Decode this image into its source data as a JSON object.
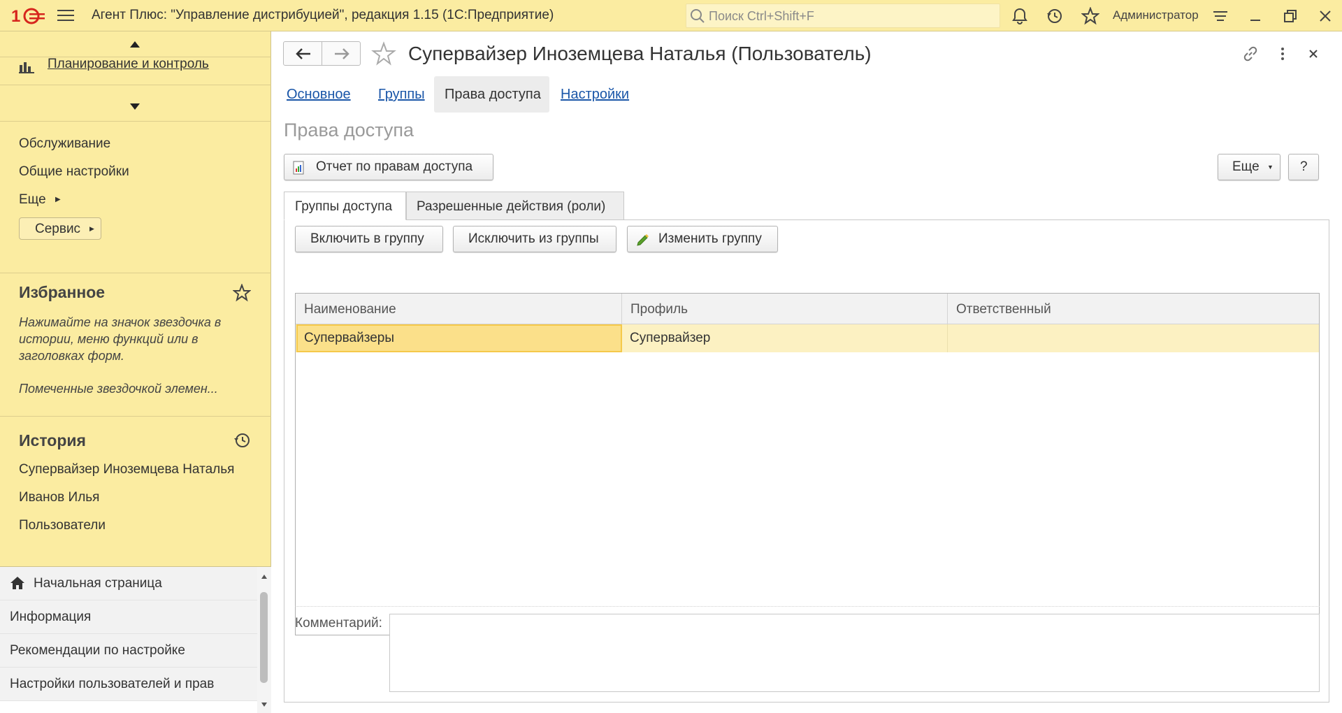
{
  "titlebar": {
    "app_title": "Агент Плюс: \"Управление дистрибуцией\", редакция 1.15  (1С:Предприятие)",
    "search_placeholder": "Поиск Ctrl+Shift+F",
    "user": "Администратор"
  },
  "sidebar": {
    "planning": "Планирование и контроль",
    "links": [
      "Обслуживание",
      "Общие настройки",
      "Еще"
    ],
    "servis": "Сервис",
    "favorites": {
      "title": "Избранное",
      "hint1": "Нажимайте на значок звездочка в истории, меню функций или в заголовках форм.",
      "hint2": "Помеченные звездочкой элемен..."
    },
    "history": {
      "title": "История",
      "items": [
        "Супервайзер Иноземцева Наталья",
        "Иванов Илья",
        "Пользователи"
      ]
    },
    "bottom_nav": [
      "Начальная страница",
      "Информация",
      "Рекомендации по настройке",
      "Настройки пользователей и прав"
    ]
  },
  "form": {
    "title": "Супервайзер Иноземцева Наталья (Пользователь)",
    "tabs": [
      "Основное",
      "Группы",
      "Права доступа",
      "Настройки"
    ],
    "section_title": "Права доступа",
    "report_button": "Отчет по правам доступа",
    "more_button": "Еще",
    "help_button": "?",
    "inner_tabs": [
      "Группы доступа",
      "Разрешенные действия (роли)"
    ],
    "actions": {
      "include": "Включить в группу",
      "exclude": "Исключить из группы",
      "edit": "Изменить группу"
    },
    "table": {
      "columns": [
        "Наименование",
        "Профиль",
        "Ответственный"
      ],
      "rows": [
        {
          "name": "Супервайзеры",
          "profile": "Супервайзер",
          "responsible": ""
        }
      ]
    },
    "comment_label": "Комментарий:",
    "comment_value": ""
  },
  "colors": {
    "accent_yellow": "#fbeca1",
    "link_blue": "#1a56a8",
    "logo_red": "#d6251d"
  }
}
